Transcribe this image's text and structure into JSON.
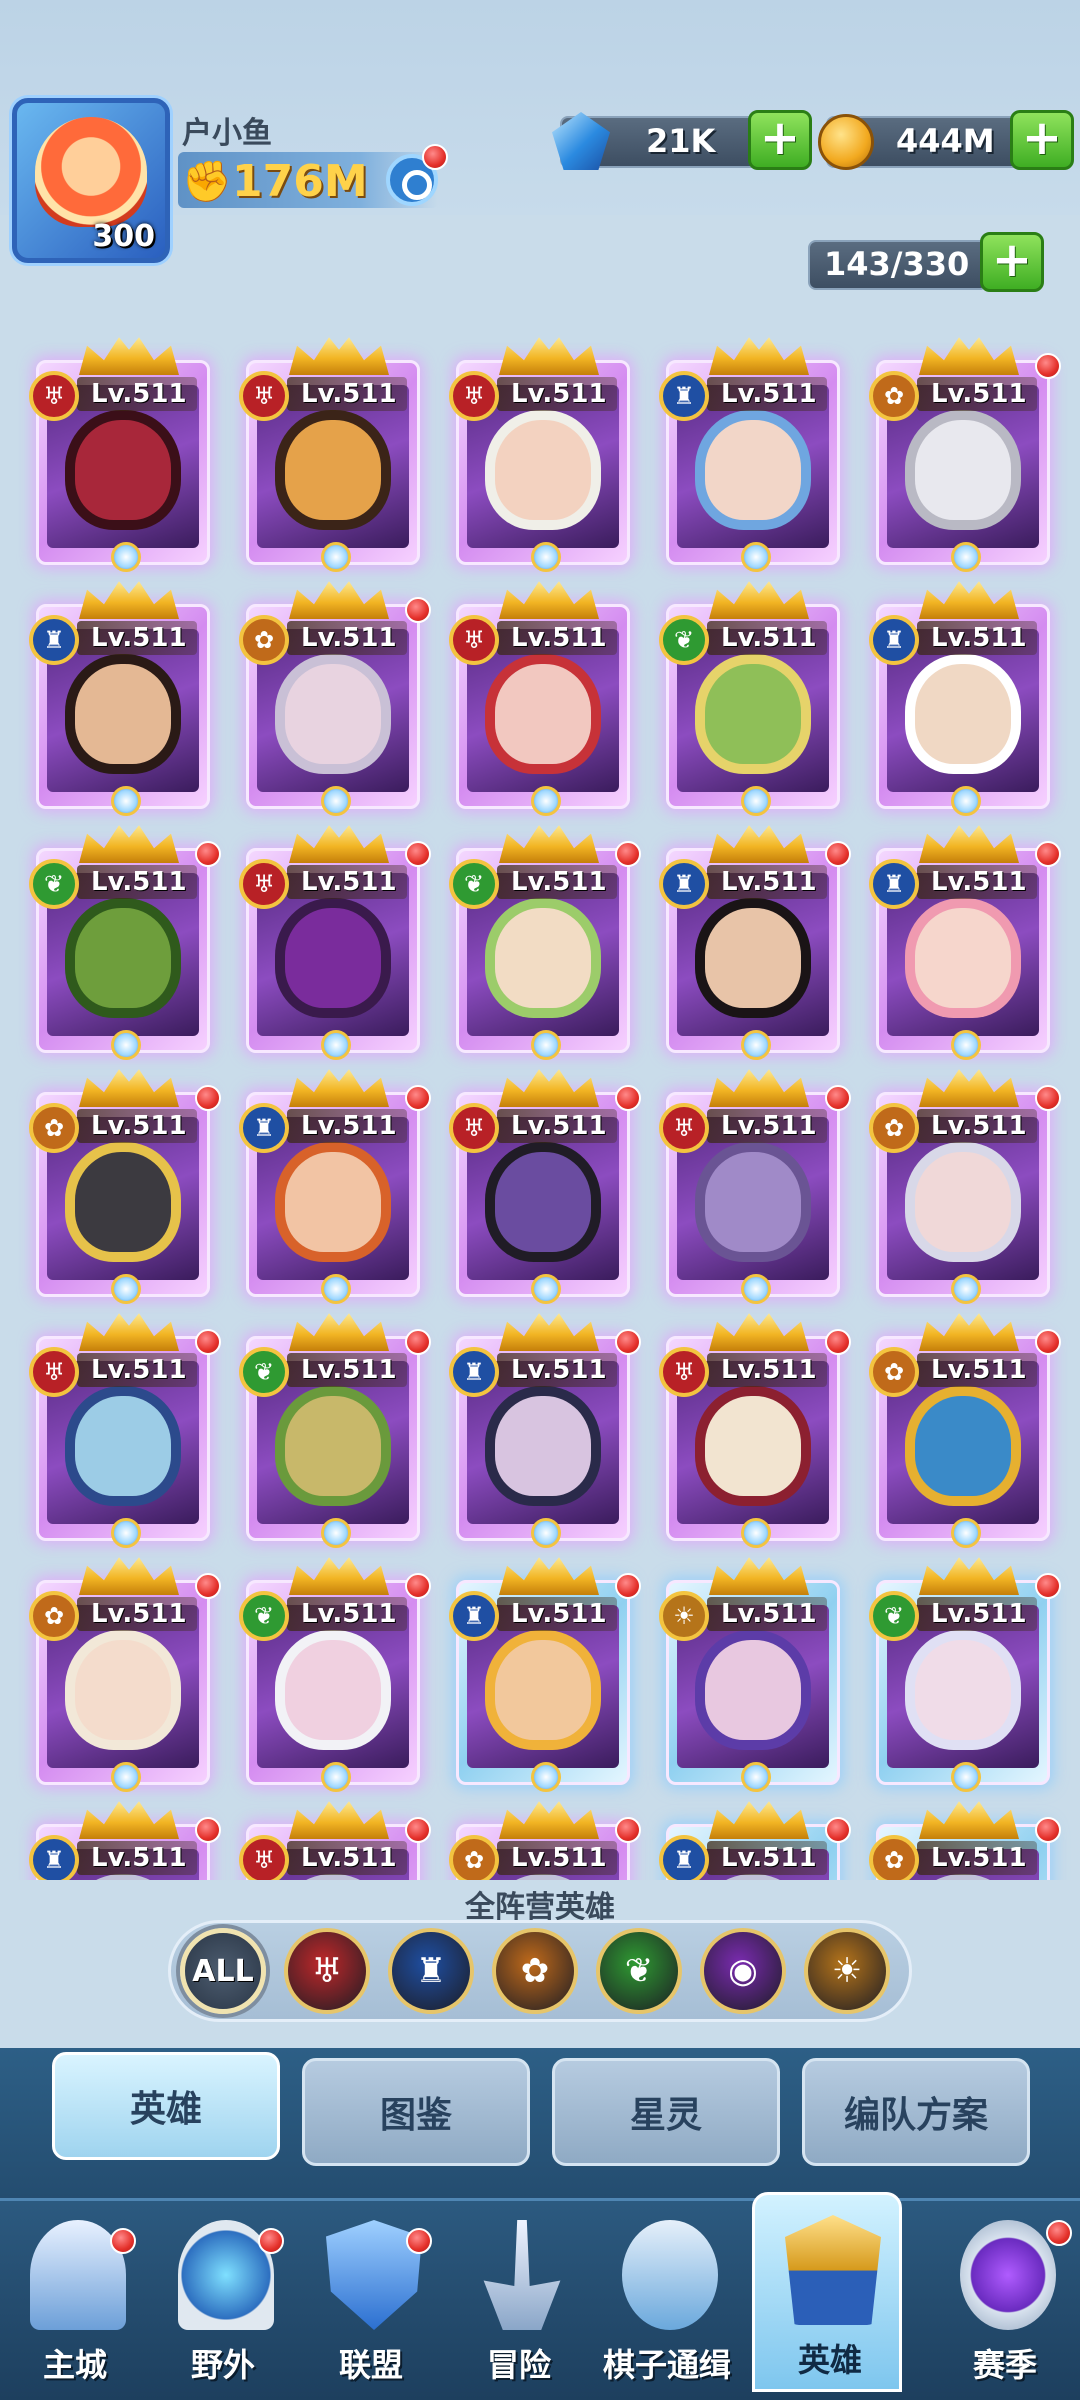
{
  "player": {
    "name": "户小鱼",
    "level": "300",
    "power": "176M"
  },
  "resources": {
    "gems": "21K",
    "gold": "444M",
    "capacity": "143/330",
    "plus": "+"
  },
  "heroes": [
    {
      "level": "Lv.511",
      "faction": "red",
      "dot": false,
      "frame": "pink"
    },
    {
      "level": "Lv.511",
      "faction": "red",
      "dot": false,
      "frame": "pink"
    },
    {
      "level": "Lv.511",
      "faction": "red",
      "dot": false,
      "frame": "pink"
    },
    {
      "level": "Lv.511",
      "faction": "blue",
      "dot": false,
      "frame": "pink"
    },
    {
      "level": "Lv.511",
      "faction": "orange",
      "dot": true,
      "frame": "pink"
    },
    {
      "level": "Lv.511",
      "faction": "blue",
      "dot": false,
      "frame": "pink"
    },
    {
      "level": "Lv.511",
      "faction": "orange",
      "dot": true,
      "frame": "pink"
    },
    {
      "level": "Lv.511",
      "faction": "red",
      "dot": false,
      "frame": "pink"
    },
    {
      "level": "Lv.511",
      "faction": "green",
      "dot": false,
      "frame": "pink"
    },
    {
      "level": "Lv.511",
      "faction": "blue",
      "dot": false,
      "frame": "pink"
    },
    {
      "level": "Lv.511",
      "faction": "green",
      "dot": true,
      "frame": "pink"
    },
    {
      "level": "Lv.511",
      "faction": "red",
      "dot": true,
      "frame": "pink"
    },
    {
      "level": "Lv.511",
      "faction": "green",
      "dot": true,
      "frame": "pink"
    },
    {
      "level": "Lv.511",
      "faction": "blue",
      "dot": true,
      "frame": "pink"
    },
    {
      "level": "Lv.511",
      "faction": "blue",
      "dot": true,
      "frame": "pink"
    },
    {
      "level": "Lv.511",
      "faction": "orange",
      "dot": true,
      "frame": "pink"
    },
    {
      "level": "Lv.511",
      "faction": "blue",
      "dot": true,
      "frame": "pink"
    },
    {
      "level": "Lv.511",
      "faction": "red",
      "dot": true,
      "frame": "pink"
    },
    {
      "level": "Lv.511",
      "faction": "red",
      "dot": true,
      "frame": "pink"
    },
    {
      "level": "Lv.511",
      "faction": "orange",
      "dot": true,
      "frame": "pink"
    },
    {
      "level": "Lv.511",
      "faction": "red",
      "dot": true,
      "frame": "pink"
    },
    {
      "level": "Lv.511",
      "faction": "green",
      "dot": true,
      "frame": "pink"
    },
    {
      "level": "Lv.511",
      "faction": "blue",
      "dot": true,
      "frame": "pink"
    },
    {
      "level": "Lv.511",
      "faction": "red",
      "dot": true,
      "frame": "pink"
    },
    {
      "level": "Lv.511",
      "faction": "orange",
      "dot": true,
      "frame": "pink"
    },
    {
      "level": "Lv.511",
      "faction": "orange",
      "dot": true,
      "frame": "pink"
    },
    {
      "level": "Lv.511",
      "faction": "green",
      "dot": true,
      "frame": "pink"
    },
    {
      "level": "Lv.511",
      "faction": "blue",
      "dot": true,
      "frame": "blue"
    },
    {
      "level": "Lv.511",
      "faction": "gold",
      "dot": false,
      "frame": "blue"
    },
    {
      "level": "Lv.511",
      "faction": "green",
      "dot": true,
      "frame": "blue"
    },
    {
      "level": "Lv.511",
      "faction": "blue",
      "dot": true,
      "frame": "pink"
    },
    {
      "level": "Lv.511",
      "faction": "red",
      "dot": true,
      "frame": "pink"
    },
    {
      "level": "Lv.511",
      "faction": "orange",
      "dot": true,
      "frame": "pink"
    },
    {
      "level": "Lv.511",
      "faction": "blue",
      "dot": true,
      "frame": "blue"
    },
    {
      "level": "Lv.511",
      "faction": "orange",
      "dot": true,
      "frame": "blue"
    }
  ],
  "filter": {
    "title": "全阵营英雄",
    "all_label": "ALL",
    "factions": [
      {
        "key": "red",
        "icon": "bat-icon",
        "color": "#c0282a"
      },
      {
        "key": "blue",
        "icon": "tower-icon",
        "color": "#1f4fa3"
      },
      {
        "key": "orange",
        "icon": "paw-icon",
        "color": "#c06a1a"
      },
      {
        "key": "green",
        "icon": "leaf-icon",
        "color": "#2f9a32"
      },
      {
        "key": "purple",
        "icon": "eye-icon",
        "color": "#7a2bb0"
      },
      {
        "key": "gold",
        "icon": "sun-icon",
        "color": "#b5741a"
      }
    ]
  },
  "subtabs": [
    "英雄",
    "图鉴",
    "星灵",
    "编队方案"
  ],
  "nav": [
    "主城",
    "野外",
    "联盟",
    "冒险",
    "棋子通缉",
    "英雄",
    "赛季"
  ],
  "colors": {
    "red": "#b82126",
    "blue": "#1f4fa3",
    "orange": "#c06a1a",
    "green": "#2f9a32",
    "gold": "#b5741a",
    "purple": "#7a2bb0"
  }
}
